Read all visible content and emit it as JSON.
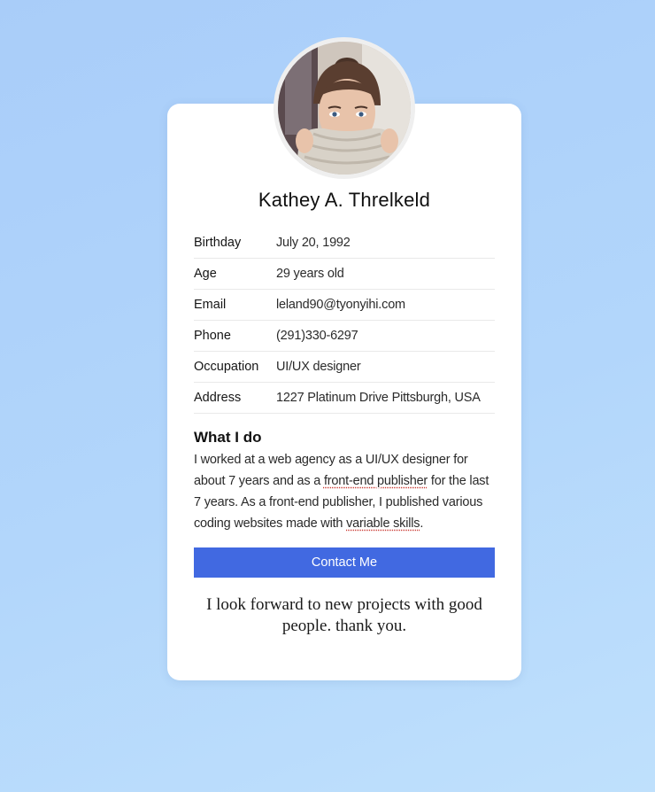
{
  "profile": {
    "name": "Kathey A. Threlkeld",
    "details": [
      {
        "label": "Birthday",
        "value": "July 20, 1992"
      },
      {
        "label": "Age",
        "value": "29 years old"
      },
      {
        "label": "Email",
        "value": "leland90@tyonyihi.com"
      },
      {
        "label": "Phone",
        "value": "(291)330-6297"
      },
      {
        "label": "Occupation",
        "value": "UI/UX designer"
      },
      {
        "label": "Address",
        "value": "1227 Platinum Drive Pittsburgh, USA"
      }
    ]
  },
  "about": {
    "title": "What I do",
    "text_1": "I worked at a web agency as a UI/UX designer for about 7 years and as a ",
    "highlight_1": "front-end publisher",
    "text_2": " for the last 7 years. As a front-end publisher, I published various coding websites made with ",
    "highlight_2": "variable skills",
    "text_3": "."
  },
  "contact_button": "Contact Me",
  "closing_message": "I look forward to new projects with good people. thank you.",
  "colors": {
    "accent": "#4169e1",
    "background": "#b2d6fb",
    "card": "#ffffff"
  }
}
